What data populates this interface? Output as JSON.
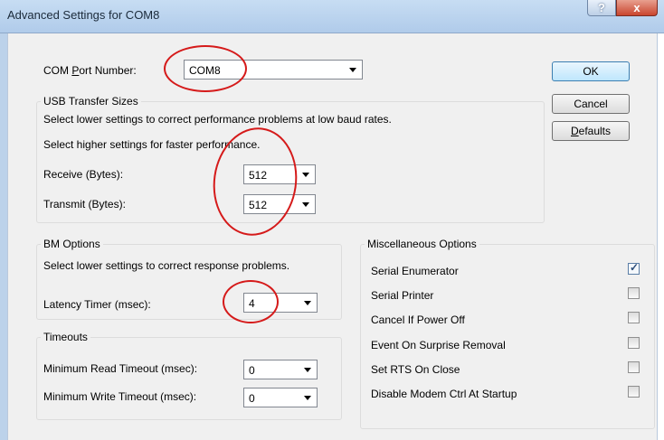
{
  "window": {
    "title": "Advanced Settings for COM8",
    "help_glyph": "?",
    "close_glyph": "x"
  },
  "com_port": {
    "label_prefix": "COM ",
    "label_accel": "P",
    "label_suffix": "ort Number:",
    "value": "COM8"
  },
  "buttons": {
    "ok": "OK",
    "cancel": "Cancel",
    "defaults_accel": "D",
    "defaults_rest": "efaults"
  },
  "usb": {
    "title": "USB Transfer Sizes",
    "hint_lower": "Select lower settings to correct performance problems at low baud rates.",
    "hint_higher": "Select higher settings for faster performance.",
    "receive_label": "Receive (Bytes):",
    "receive_value": "512",
    "transmit_label": "Transmit (Bytes):",
    "transmit_value": "512"
  },
  "bm": {
    "title": "BM Options",
    "hint": "Select lower settings to correct response problems.",
    "latency_label": "Latency Timer (msec):",
    "latency_value": "4"
  },
  "timeouts": {
    "title": "Timeouts",
    "read_label": "Minimum Read Timeout (msec):",
    "read_value": "0",
    "write_label": "Minimum Write Timeout (msec):",
    "write_value": "0"
  },
  "misc": {
    "title": "Miscellaneous Options",
    "options": [
      {
        "label": "Serial Enumerator",
        "checked": true,
        "check_glyph": "✓"
      },
      {
        "label": "Serial Printer",
        "checked": false
      },
      {
        "label": "Cancel If Power Off",
        "checked": false
      },
      {
        "label": "Event On Surprise Removal",
        "checked": false
      },
      {
        "label": "Set RTS On Close",
        "checked": false
      },
      {
        "label": "Disable Modem Ctrl At Startup",
        "checked": false
      }
    ]
  },
  "annotation_color": "#d51a1a"
}
